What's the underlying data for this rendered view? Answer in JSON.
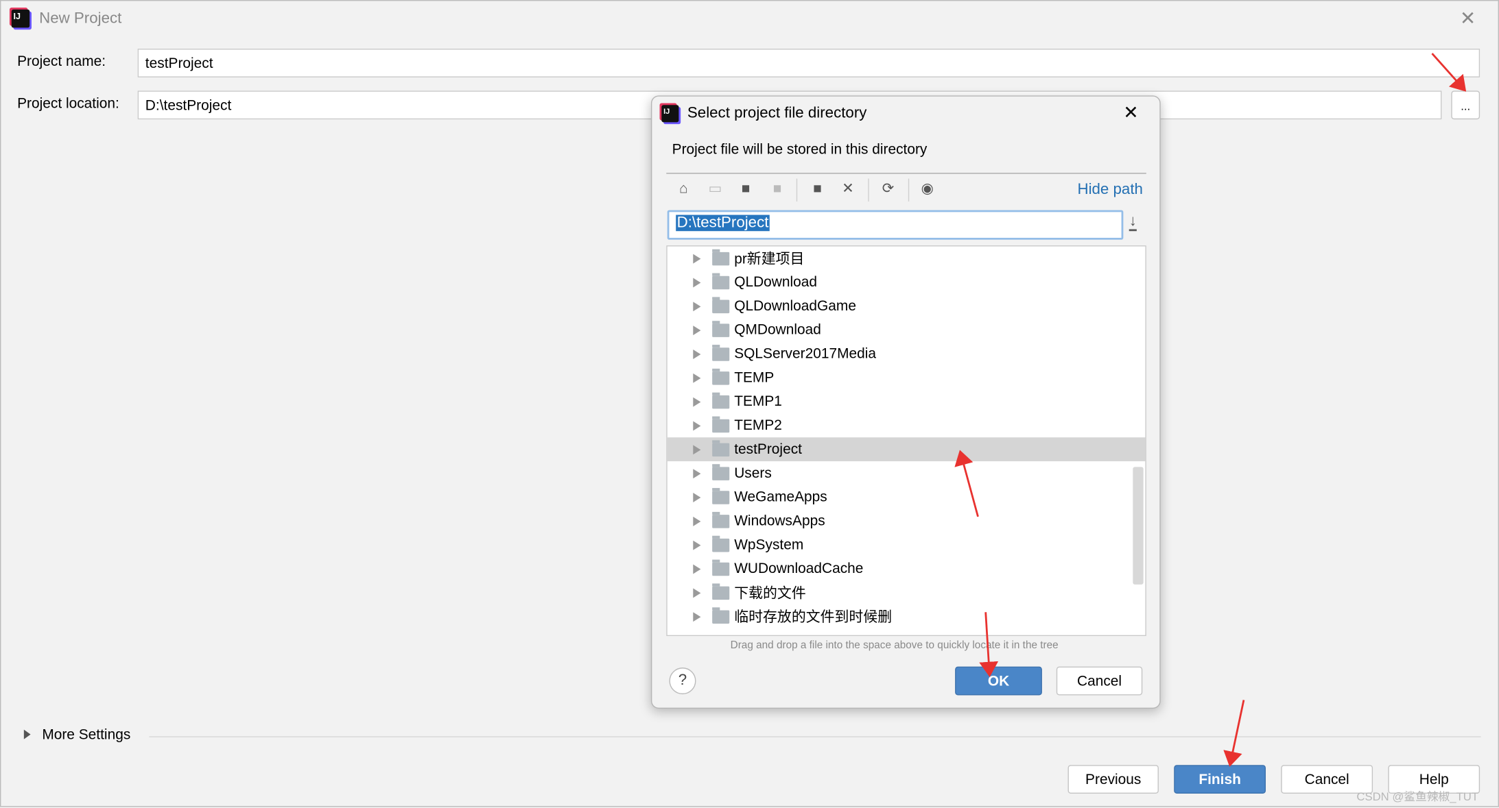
{
  "window": {
    "title": "New Project",
    "close_icon": "close-icon"
  },
  "form": {
    "project_name_label": "Project name:",
    "project_name_value": "testProject",
    "project_location_label": "Project location:",
    "project_location_value": "D:\\testProject",
    "browse_label": "..."
  },
  "more_settings": "More Settings",
  "buttons": {
    "previous": "Previous",
    "finish": "Finish",
    "cancel": "Cancel",
    "help": "Help"
  },
  "watermark": "CSDN @鲨鱼辣椒_TUT",
  "dialog": {
    "title": "Select project file directory",
    "subtitle": "Project file will be stored in this directory",
    "toolbar": [
      "home-icon",
      "desktop-icon",
      "project-folder-icon",
      "module-folder-icon",
      "new-folder-icon",
      "delete-icon",
      "refresh-icon",
      "show-hidden-icon"
    ],
    "hide_path": "Hide path",
    "path_value": "D:\\testProject",
    "tree": [
      {
        "label": "pr新建项目"
      },
      {
        "label": "QLDownload"
      },
      {
        "label": "QLDownloadGame"
      },
      {
        "label": "QMDownload"
      },
      {
        "label": "SQLServer2017Media"
      },
      {
        "label": "TEMP"
      },
      {
        "label": "TEMP1"
      },
      {
        "label": "TEMP2"
      },
      {
        "label": "testProject",
        "selected": true
      },
      {
        "label": "Users"
      },
      {
        "label": "WeGameApps"
      },
      {
        "label": "WindowsApps"
      },
      {
        "label": "WpSystem"
      },
      {
        "label": "WUDownloadCache"
      },
      {
        "label": "下载的文件"
      },
      {
        "label": "临时存放的文件到时候删"
      }
    ],
    "hint": "Drag and drop a file into the space above to quickly locate it in the tree",
    "help": "?",
    "ok": "OK",
    "cancel": "Cancel"
  },
  "colors": {
    "accent": "#4a86c8",
    "annotation": "#e8322f",
    "selection": "#2675bf",
    "link": "#2470b3"
  }
}
